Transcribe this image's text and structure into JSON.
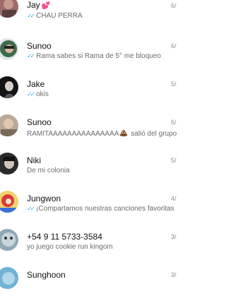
{
  "chats": [
    {
      "name": "Jay",
      "name_suffix": "💕",
      "time": "6/",
      "message": "CHAU PERRA",
      "read_ticks": true,
      "avatar_color": "#9e6b6b"
    },
    {
      "name": "Sunoo",
      "time": "6/",
      "message": "Rama sabes si Rama de 5° me bloqueo",
      "read_ticks": true,
      "avatar_color": "#3d6b4a"
    },
    {
      "name": "Jake",
      "time": "5/",
      "message": "okis",
      "read_ticks": true,
      "avatar_color": "#141414"
    },
    {
      "name": "Sunoo",
      "time": "6/",
      "message_before": "RAMITAAAAAAAAAAAAAAA",
      "message_after": " salió del grupo.",
      "read_ticks": false,
      "avatar_color": "#7a6a5a"
    },
    {
      "name": "Niki",
      "time": "5/",
      "message": "De mi colonia",
      "read_ticks": false,
      "avatar_color": "#2a2a2a"
    },
    {
      "name": "Jungwon",
      "time": "4/",
      "message": "¡Compartamos nuestras canciones favoritas",
      "read_ticks": true,
      "avatar_color": "#d63c3c"
    },
    {
      "name": "+54 9 11 5733-3584",
      "time": "3/",
      "message": "yo juego cookie run kingom",
      "read_ticks": false,
      "avatar_color": "#8fa9b5"
    },
    {
      "name": "Sunghoon",
      "time": "3/",
      "message": "",
      "read_ticks": false,
      "avatar_color": "#6fb2d6"
    }
  ],
  "icons": {
    "read": "double-check-icon",
    "poo": "pile-of-poo-icon",
    "heart": "two-hearts-icon"
  },
  "colors": {
    "ticks": "#34b7f1",
    "name": "#111111",
    "message": "#6b6b6b",
    "time": "#8e8e8e"
  }
}
